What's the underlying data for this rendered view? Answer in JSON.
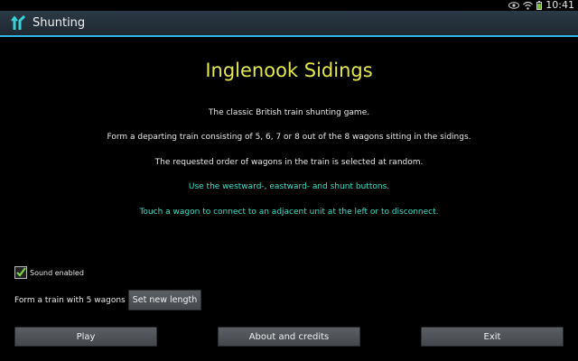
{
  "status_bar": {
    "time": "10:41"
  },
  "action_bar": {
    "title": "Shunting"
  },
  "main": {
    "title": "Inglenook Sidings",
    "paragraphs": [
      "The classic British train shunting game.",
      "Form a departing train consisting of 5, 6, 7 or 8 out of the 8 wagons sitting in the sidings.",
      "The requested order of wagons in the train is selected at random.",
      "Use the westward-, eastward- and shunt buttons.",
      "Touch a wagon to connect to an adjacent unit at the left or to disconnect."
    ]
  },
  "settings": {
    "sound_label": "Sound enabled",
    "sound_checked": true,
    "train_length_text": "Form a train with 5 wagons",
    "set_length_label": "Set new length"
  },
  "buttons": {
    "play": "Play",
    "about": "About and credits",
    "exit": "Exit"
  },
  "colors": {
    "title": "#e5e84a",
    "accent_text": "#3ee0c8",
    "action_bar_underline": "#33b5e5"
  }
}
